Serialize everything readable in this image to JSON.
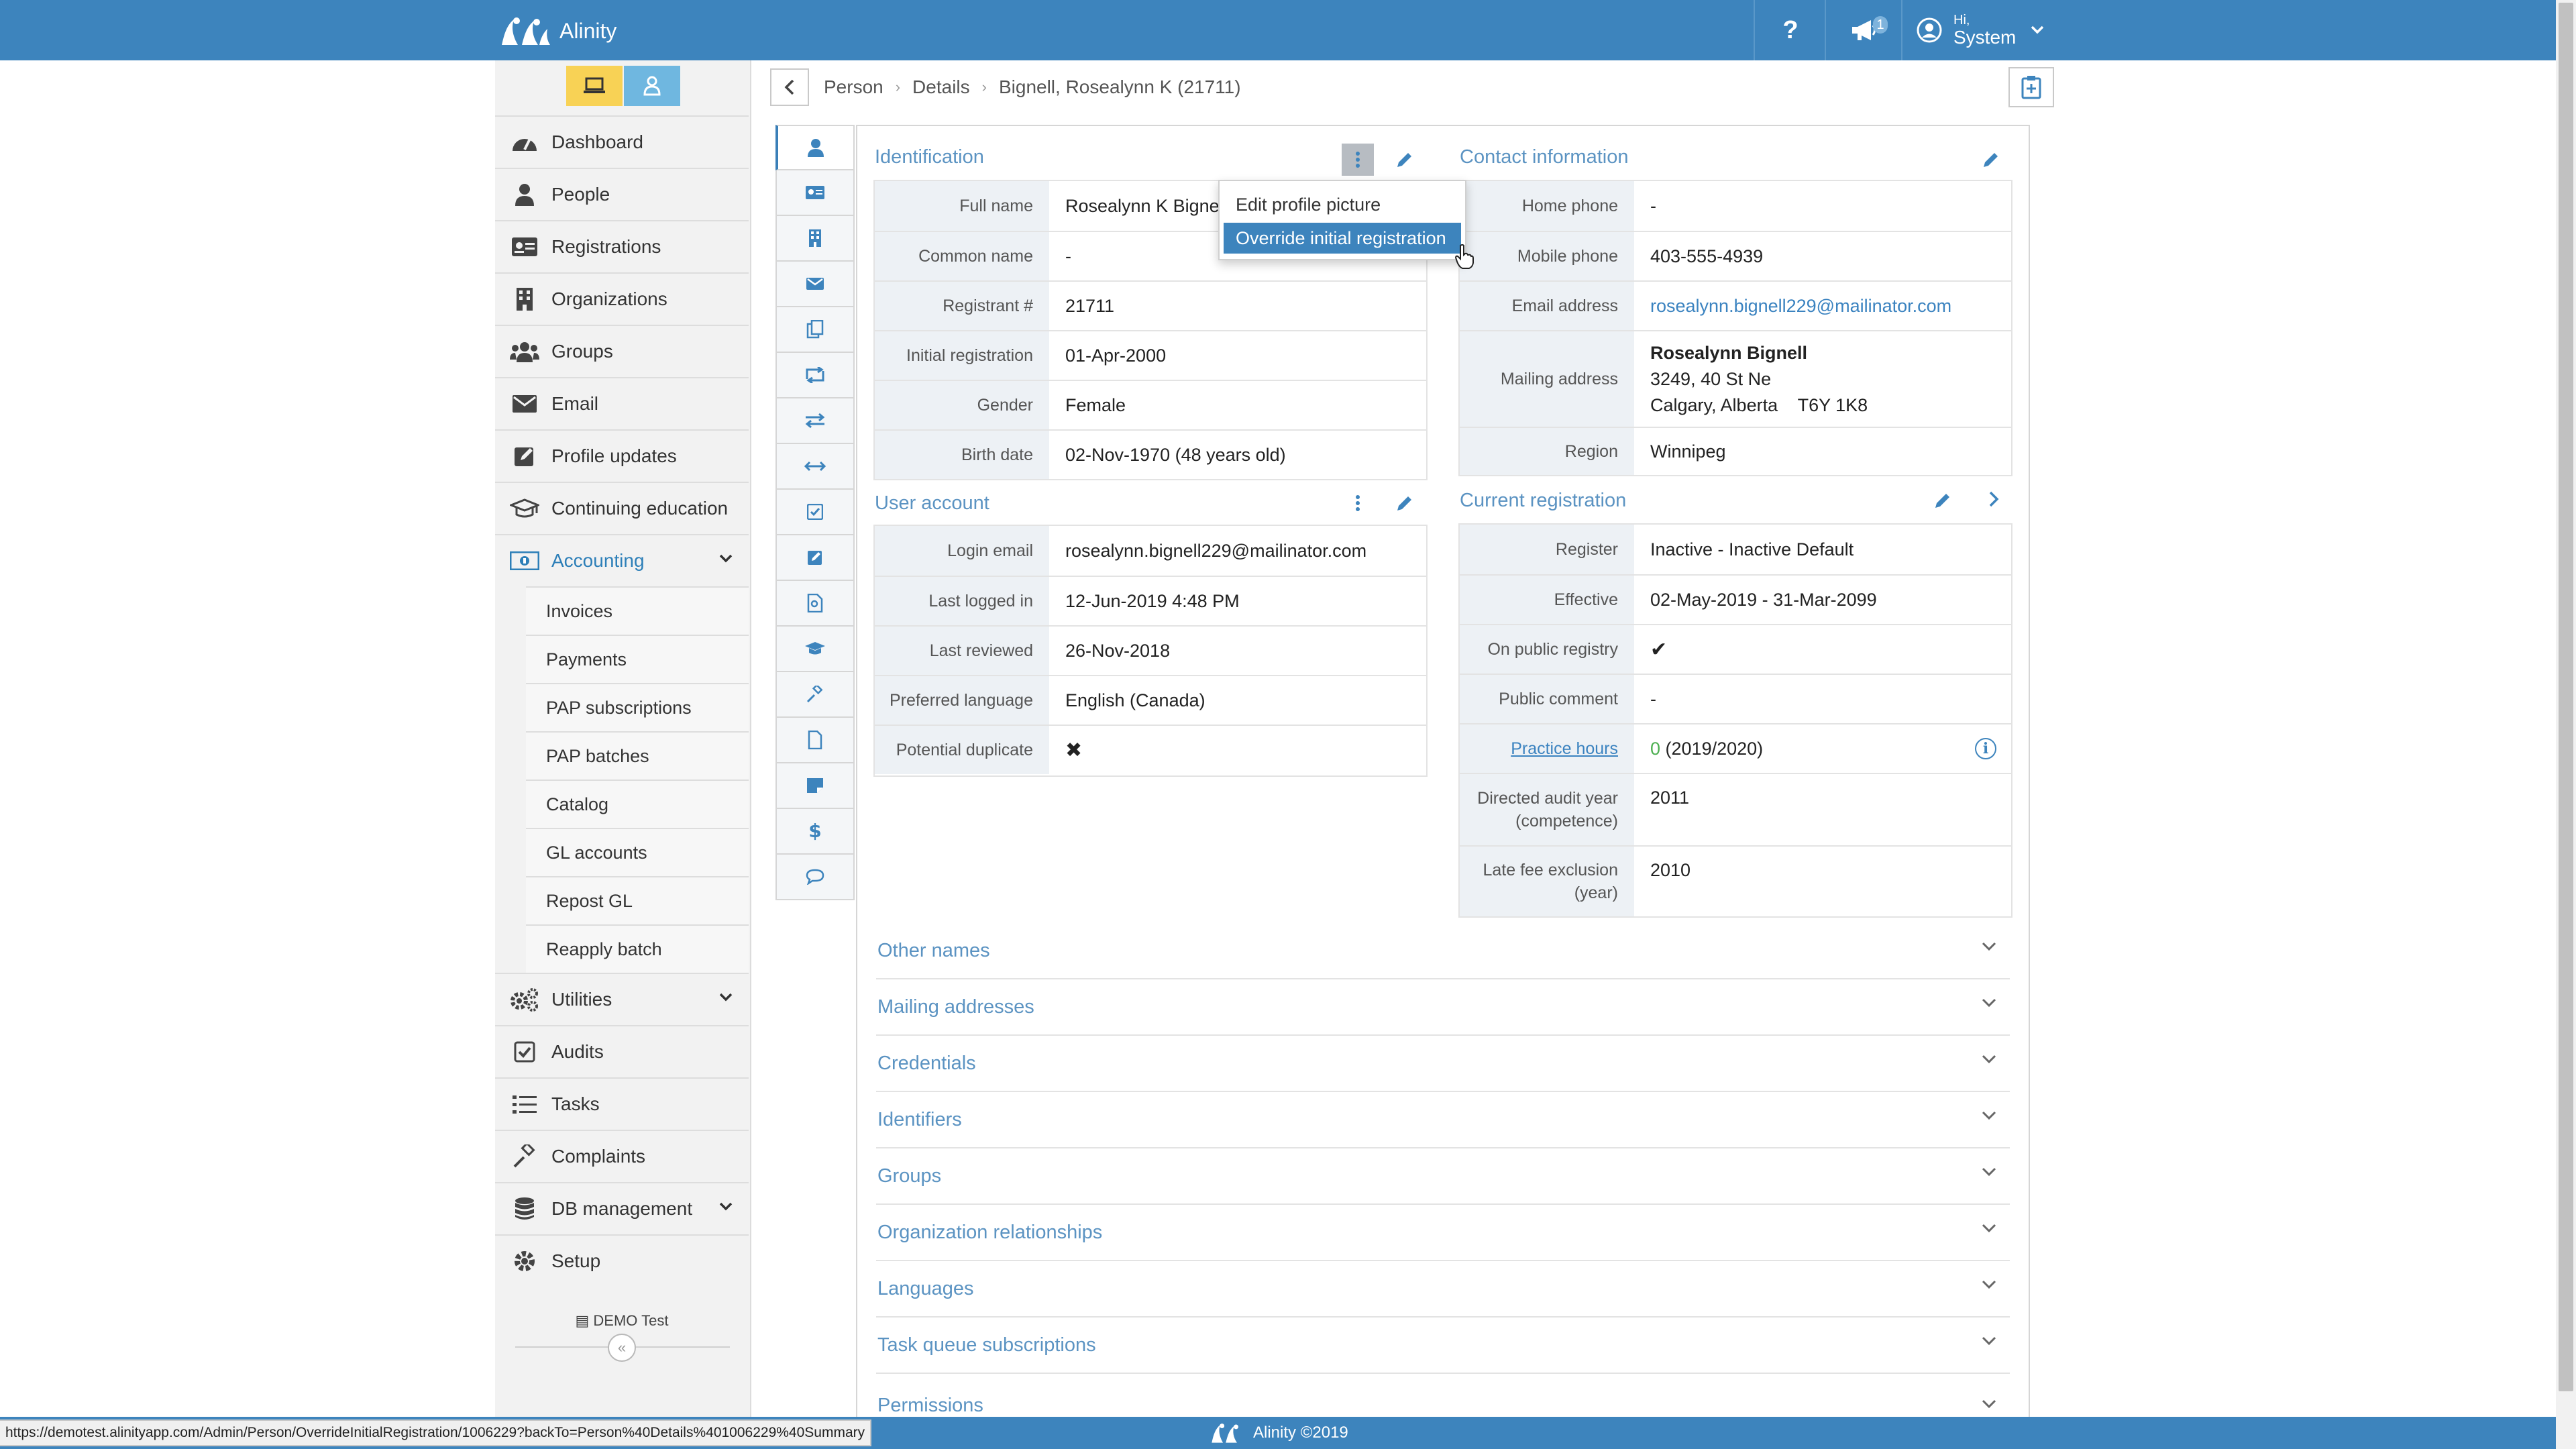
{
  "app": {
    "name": "Alinity",
    "footer": "Alinity ©2019",
    "environment": "DEMO Test"
  },
  "topbar": {
    "help_label": "?",
    "notification_count": "1",
    "user_greeting": "Hi,",
    "user_name": "System"
  },
  "sidebar": {
    "items": [
      {
        "label": "Dashboard",
        "icon": "dashboard-icon"
      },
      {
        "label": "People",
        "icon": "person-icon"
      },
      {
        "label": "Registrations",
        "icon": "id-card-icon"
      },
      {
        "label": "Organizations",
        "icon": "building-icon"
      },
      {
        "label": "Groups",
        "icon": "users-icon"
      },
      {
        "label": "Email",
        "icon": "envelope-icon"
      },
      {
        "label": "Profile updates",
        "icon": "edit-icon"
      },
      {
        "label": "Continuing education",
        "icon": "graduation-cap-icon"
      },
      {
        "label": "Accounting",
        "icon": "money-icon"
      }
    ],
    "accounting_subitems": [
      "Invoices",
      "Payments",
      "PAP subscriptions",
      "PAP batches",
      "Catalog",
      "GL accounts",
      "Repost GL",
      "Reapply batch"
    ],
    "items_after": [
      {
        "label": "Utilities",
        "icon": "cogs-icon"
      },
      {
        "label": "Audits",
        "icon": "checkbox-icon"
      },
      {
        "label": "Tasks",
        "icon": "tasks-icon"
      },
      {
        "label": "Complaints",
        "icon": "gavel-icon"
      },
      {
        "label": "DB management",
        "icon": "database-icon"
      },
      {
        "label": "Setup",
        "icon": "gear-icon"
      }
    ],
    "collapse_label": "«"
  },
  "breadcrumb": {
    "items": [
      "Person",
      "Details",
      "Bignell, Rosealynn K (21711)"
    ]
  },
  "identification": {
    "title": "Identification",
    "rows": [
      {
        "label": "Full name",
        "value": "Rosealynn K Bignell"
      },
      {
        "label": "Common name",
        "value": "-"
      },
      {
        "label": "Registrant #",
        "value": "21711"
      },
      {
        "label": "Initial registration",
        "value": "01-Apr-2000"
      },
      {
        "label": "Gender",
        "value": "Female"
      },
      {
        "label": "Birth date",
        "value": "02-Nov-1970 (48 years old)"
      }
    ]
  },
  "menu": {
    "items": [
      "Edit profile picture",
      "Override initial registration"
    ]
  },
  "contact": {
    "title": "Contact information",
    "home_phone_label": "Home phone",
    "home_phone": "-",
    "mobile_phone_label": "Mobile phone",
    "mobile_phone": "403-555-4939",
    "email_label": "Email address",
    "email": "rosealynn.bignell229@mailinator.com",
    "mailing_label": "Mailing address",
    "mailing_name": "Rosealynn Bignell",
    "mailing_line1": "3249, 40 St Ne",
    "mailing_line2": "Calgary, Alberta    T6Y 1K8",
    "region_label": "Region",
    "region": "Winnipeg"
  },
  "user_account": {
    "title": "User account",
    "rows": [
      {
        "label": "Login email",
        "value": "rosealynn.bignell229@mailinator.com"
      },
      {
        "label": "Last logged in",
        "value": "12-Jun-2019 4:48 PM"
      },
      {
        "label": "Last reviewed",
        "value": "26-Nov-2018"
      },
      {
        "label": "Preferred language",
        "value": "English (Canada)"
      },
      {
        "label": "Potential duplicate",
        "value": "✖"
      }
    ]
  },
  "current_registration": {
    "title": "Current registration",
    "register_label": "Register",
    "register": "Inactive - Inactive Default",
    "effective_label": "Effective",
    "effective": "02-May-2019 - 31-Mar-2099",
    "public_registry_label": "On public registry",
    "public_registry": "✔",
    "public_comment_label": "Public comment",
    "public_comment": "-",
    "practice_hours_label": "Practice hours",
    "practice_hours_value": "0",
    "practice_hours_period": " (2019/2020)",
    "audit_label_1": "Directed audit year",
    "audit_label_2": "(competence)",
    "audit_year": "2011",
    "latefee_label_1": "Late fee exclusion",
    "latefee_label_2": "(year)",
    "latefee_year": "2010"
  },
  "accordions": [
    "Other names",
    "Mailing addresses",
    "Credentials",
    "Identifiers",
    "Groups",
    "Organization relationships",
    "Languages",
    "Task queue subscriptions",
    "Permissions"
  ],
  "status_url": "https://demotest.alinityapp.com/Admin/Person/OverrideInitialRegistration/1006229?backTo=Person%40Details%401006229%40Summary",
  "colors": {
    "brand": "#3d84bd",
    "link": "#3b83c0",
    "label_bg": "#edf1f5",
    "toggle_yellow": "#f8d255",
    "toggle_blue": "#6fb7e0"
  }
}
